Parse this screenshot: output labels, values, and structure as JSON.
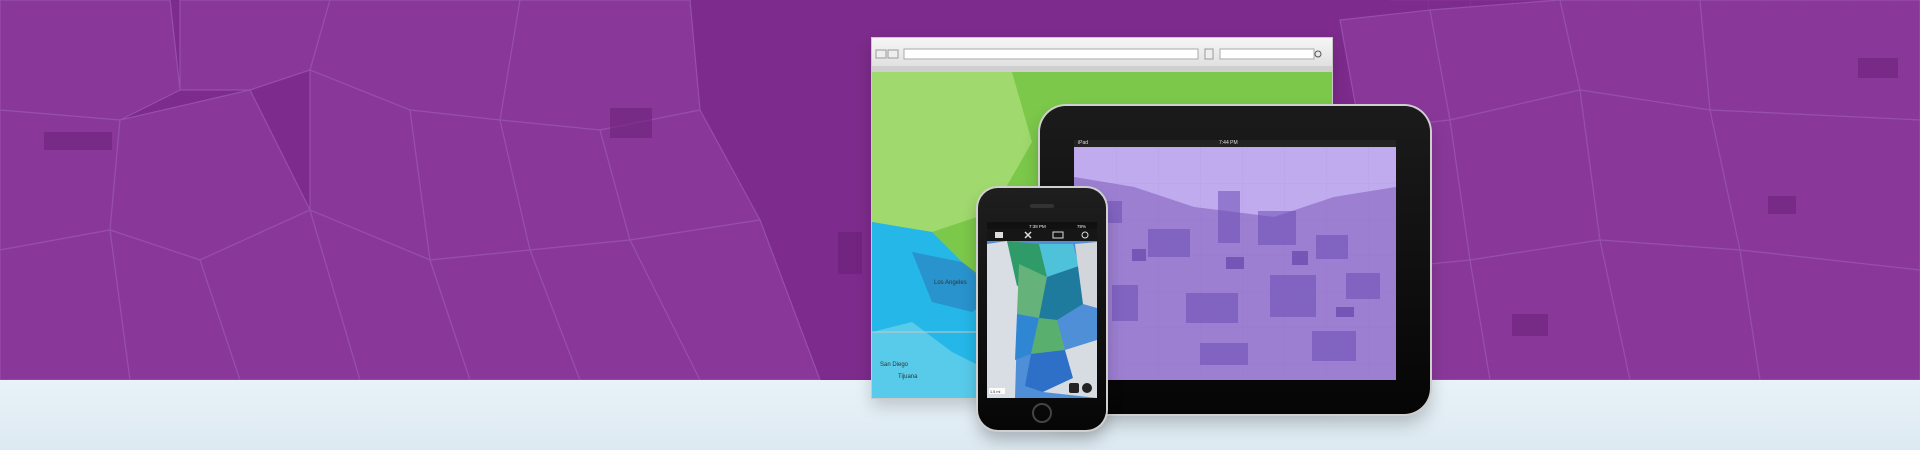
{
  "colors": {
    "banner_purple": "#7d2b8c",
    "floor_light_blue": "#e3eef6",
    "map_green": "#7bc84a",
    "map_blue": "#25b7e8",
    "tablet_map_purple": "#a78bd8",
    "phone_map_blue": "#4f8fd8"
  },
  "devices": {
    "monitor": {
      "map_labels": [
        "Los Angeles",
        "San Diego",
        "Tijuana"
      ]
    },
    "tablet": {
      "status_left": "iPad",
      "status_time": "7:44 PM"
    },
    "phone": {
      "status_time": "7:38 PM",
      "status_battery": "78%",
      "scale_label": "1.5 mi"
    }
  },
  "icons": [
    "browser-back-icon",
    "browser-forward-icon",
    "browser-refresh-icon",
    "browser-search-icon",
    "map-layers-icon",
    "tools-icon",
    "bookmarks-icon",
    "search-icon",
    "locate-icon",
    "info-icon"
  ]
}
